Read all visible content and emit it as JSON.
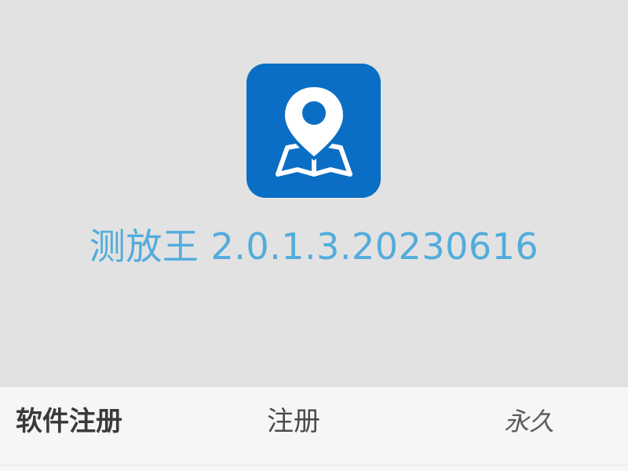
{
  "app": {
    "icon": "map-pin-on-open-map-icon",
    "icon_color": "#0a6fc4",
    "title_color": "#52acdb",
    "name_version": "测放王 2.0.1.3.20230616"
  },
  "registration_row": {
    "label": "软件注册",
    "action_label": "注册",
    "value": "永久"
  }
}
